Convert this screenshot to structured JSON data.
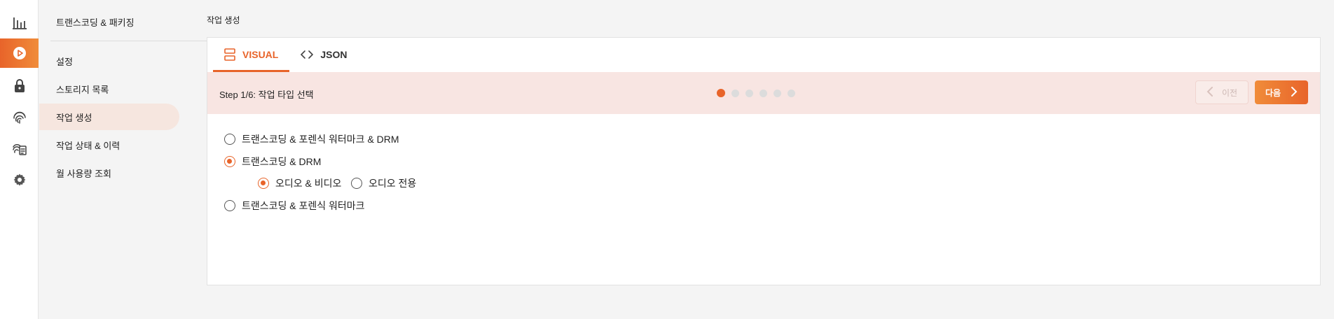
{
  "rail": {
    "items": [
      {
        "icon": "bar-chart-icon",
        "active": false
      },
      {
        "icon": "play-circle-icon",
        "active": true
      },
      {
        "icon": "lock-icon",
        "active": false
      },
      {
        "icon": "fingerprint-icon",
        "active": false
      },
      {
        "icon": "fingerprint-document-icon",
        "active": false
      },
      {
        "icon": "gear-icon",
        "active": false
      }
    ]
  },
  "submenu": {
    "title": "트랜스코딩 & 패키징",
    "items": [
      {
        "label": "설정"
      },
      {
        "label": "스토리지 목록"
      },
      {
        "label": "작업 생성",
        "active": true
      },
      {
        "label": "작업 상태 & 이력"
      },
      {
        "label": "월 사용량 조회"
      }
    ]
  },
  "page": {
    "title": "작업 생성"
  },
  "tabs": [
    {
      "label": "VISUAL",
      "icon": "layout-rows-icon",
      "active": true
    },
    {
      "label": "JSON",
      "icon": "code-brackets-icon",
      "active": false
    }
  ],
  "stepper": {
    "label": "Step 1/6: 작업 타입 선택",
    "current_step": 1,
    "total_steps": 6,
    "prev_label": "이전",
    "next_label": "다음"
  },
  "options": {
    "job_types": [
      {
        "label": "트랜스코딩 & 포렌식 워터마크 & DRM",
        "checked": false
      },
      {
        "label": "트랜스코딩 & DRM",
        "checked": true
      },
      {
        "label": "트랜스코딩 & 포렌식 워터마크",
        "checked": false
      }
    ],
    "media_types": [
      {
        "label": "오디오 & 비디오",
        "checked": true
      },
      {
        "label": "오디오 전용",
        "checked": false
      }
    ]
  },
  "colors": {
    "accent": "#e8642a",
    "stepbar_bg": "#f8e5e2",
    "active_menu_bg": "#f6e6df"
  }
}
